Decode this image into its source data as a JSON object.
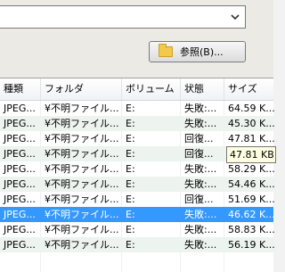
{
  "combo": {
    "value": ""
  },
  "browse_button": {
    "label": "参照(B)..."
  },
  "list": {
    "columns": [
      "種類",
      "フォルダ",
      "ボリューム",
      "状態",
      "サイズ"
    ],
    "rows": [
      [
        "JPEG...",
        "¥不明ファイル...",
        "E:",
        "失敗:...",
        "64.59 K..."
      ],
      [
        "JPEG...",
        "¥不明ファイル...",
        "E:",
        "失敗:...",
        "45.30 K..."
      ],
      [
        "JPEG...",
        "¥不明ファイル...",
        "E:",
        "回復...",
        "47.81 K..."
      ],
      [
        "JPEG...",
        "¥不明ファイル...",
        "E:",
        "回復...",
        ""
      ],
      [
        "JPEG...",
        "¥不明ファイル...",
        "E:",
        "失敗:...",
        "58.29 K..."
      ],
      [
        "JPEG...",
        "¥不明ファイル...",
        "E:",
        "失敗:...",
        "54.46 K..."
      ],
      [
        "JPEG...",
        "¥不明ファイル...",
        "E:",
        "回復...",
        "51.69 K..."
      ],
      [
        "JPEG...",
        "¥不明ファイル...",
        "E:",
        "失敗:...",
        "46.62 K..."
      ],
      [
        "JPEG...",
        "¥不明ファイル...",
        "E:",
        "失敗:...",
        "58.83 K..."
      ],
      [
        "JPEG...",
        "¥不明ファイル...",
        "E:",
        "失敗:...",
        "56.19 K..."
      ]
    ],
    "selected_row": 7,
    "tooltip": "47.81 KB ("
  }
}
